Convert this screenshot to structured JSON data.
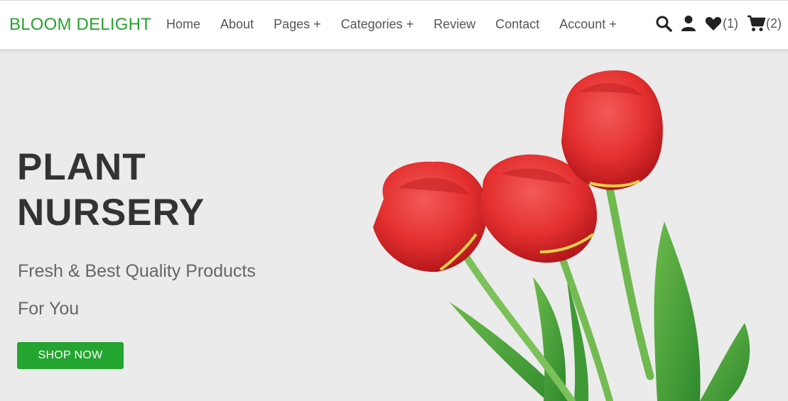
{
  "brand": {
    "name": "BLOOM DELIGHT",
    "color": "#27a22f"
  },
  "nav": {
    "links": [
      "Home",
      "About",
      "Pages +",
      "Categories +",
      "Review",
      "Contact",
      "Account +"
    ]
  },
  "icons": {
    "search": "search-icon",
    "user": "user-icon",
    "wishlist": "heart-icon",
    "wishlist_count": "(1)",
    "cart": "cart-icon",
    "cart_count": "(2)"
  },
  "hero": {
    "title_line1": "PLANT",
    "title_line2": "NURSERY",
    "subtitle_line1": "Fresh & Best Quality Products",
    "subtitle_line2": "For You",
    "button_label": "SHOP NOW",
    "accent": "#23a530",
    "image": "red-tulips-image"
  }
}
